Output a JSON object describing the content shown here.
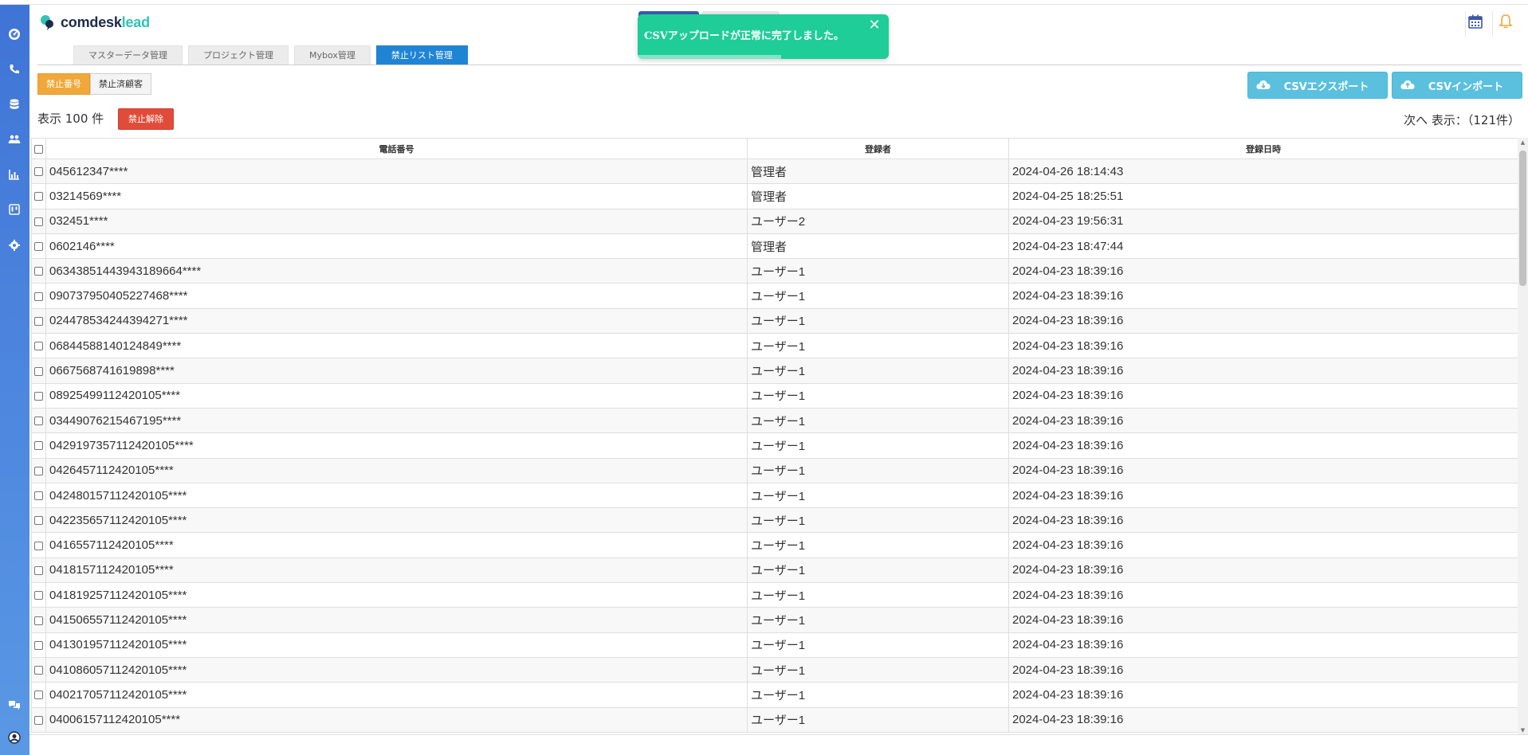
{
  "app": {
    "brand": "comdesk",
    "brand_accent": "lead"
  },
  "tabs": [
    {
      "label": "マスターデータ管理",
      "active": false
    },
    {
      "label": "プロジェクト管理",
      "active": false
    },
    {
      "label": "Mybox管理",
      "active": false
    },
    {
      "label": "禁止リスト管理",
      "active": true
    }
  ],
  "toast": {
    "message": "CSVアップロードが正常に完了しました。",
    "close": "✕"
  },
  "sub_tabs": [
    {
      "label": "禁止番号",
      "active": true
    },
    {
      "label": "禁止済顧客",
      "active": false
    }
  ],
  "actions": {
    "export": "CSVエクスポート",
    "import": "CSVインポート",
    "unban": "禁止解除"
  },
  "list": {
    "display_count": "表示 100 件",
    "pager": "次へ 表示：（121件）"
  },
  "table": {
    "headers": [
      "電話番号",
      "登録者",
      "登録日時"
    ],
    "rows": [
      [
        "045612347****",
        "管理者",
        "2024-04-26 18:14:43"
      ],
      [
        "03214569****",
        "管理者",
        "2024-04-25 18:25:51"
      ],
      [
        "032451****",
        "ユーザー2",
        "2024-04-23 19:56:31"
      ],
      [
        "0602146****",
        "管理者",
        "2024-04-23 18:47:44"
      ],
      [
        "06343851443943189664****",
        "ユーザー1",
        "2024-04-23 18:39:16"
      ],
      [
        "090737950405227468****",
        "ユーザー1",
        "2024-04-23 18:39:16"
      ],
      [
        "024478534244394271****",
        "ユーザー1",
        "2024-04-23 18:39:16"
      ],
      [
        "06844588140124849****",
        "ユーザー1",
        "2024-04-23 18:39:16"
      ],
      [
        "0667568741619898****",
        "ユーザー1",
        "2024-04-23 18:39:16"
      ],
      [
        "08925499112420105****",
        "ユーザー1",
        "2024-04-23 18:39:16"
      ],
      [
        "03449076215467195****",
        "ユーザー1",
        "2024-04-23 18:39:16"
      ],
      [
        "0429197357112420105****",
        "ユーザー1",
        "2024-04-23 18:39:16"
      ],
      [
        "0426457112420105****",
        "ユーザー1",
        "2024-04-23 18:39:16"
      ],
      [
        "042480157112420105****",
        "ユーザー1",
        "2024-04-23 18:39:16"
      ],
      [
        "042235657112420105****",
        "ユーザー1",
        "2024-04-23 18:39:16"
      ],
      [
        "0416557112420105****",
        "ユーザー1",
        "2024-04-23 18:39:16"
      ],
      [
        "0418157112420105****",
        "ユーザー1",
        "2024-04-23 18:39:16"
      ],
      [
        "041819257112420105****",
        "ユーザー1",
        "2024-04-23 18:39:16"
      ],
      [
        "041506557112420105****",
        "ユーザー1",
        "2024-04-23 18:39:16"
      ],
      [
        "041301957112420105****",
        "ユーザー1",
        "2024-04-23 18:39:16"
      ],
      [
        "041086057112420105****",
        "ユーザー1",
        "2024-04-23 18:39:16"
      ],
      [
        "040217057112420105****",
        "ユーザー1",
        "2024-04-23 18:39:16"
      ],
      [
        "04006157112420105****",
        "ユーザー1",
        "2024-04-23 18:39:16"
      ]
    ]
  },
  "icons": {
    "sidebar": [
      "dashboard-icon",
      "phone-icon",
      "database-icon",
      "users-icon",
      "chart-icon",
      "board-icon",
      "settings-icon",
      "chat-icon",
      "user-circle-icon"
    ],
    "header": [
      "calendar-icon",
      "bell-icon"
    ]
  },
  "colors": {
    "active_tab": "#1f84d4",
    "toast": "#1ecd97",
    "sub_active": "#f0a83a",
    "csv_button": "#5bc0de",
    "danger": "#e04b3a",
    "sidebar": "#3f74d6"
  }
}
